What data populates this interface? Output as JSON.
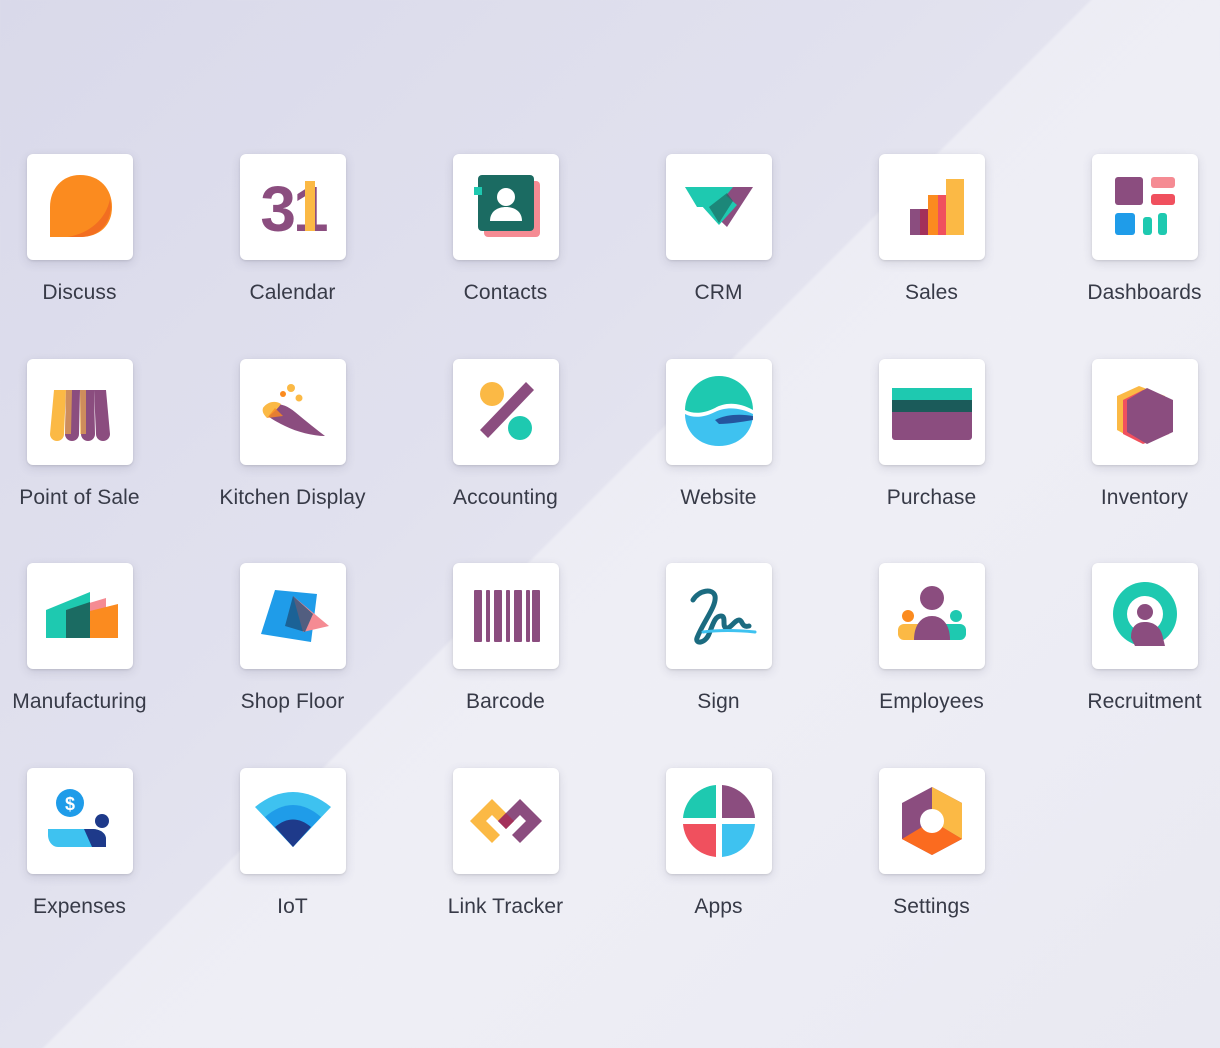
{
  "apps": [
    {
      "label": "Discuss",
      "icon": "discuss-icon"
    },
    {
      "label": "Calendar",
      "icon": "calendar-icon",
      "icon_text": "31"
    },
    {
      "label": "Contacts",
      "icon": "contacts-icon"
    },
    {
      "label": "CRM",
      "icon": "crm-icon"
    },
    {
      "label": "Sales",
      "icon": "sales-icon"
    },
    {
      "label": "Dashboards",
      "icon": "dashboards-icon"
    },
    {
      "label": "Point of Sale",
      "icon": "point-of-sale-icon"
    },
    {
      "label": "Kitchen Display",
      "icon": "kitchen-display-icon"
    },
    {
      "label": "Accounting",
      "icon": "accounting-icon"
    },
    {
      "label": "Website",
      "icon": "website-icon"
    },
    {
      "label": "Purchase",
      "icon": "purchase-icon"
    },
    {
      "label": "Inventory",
      "icon": "inventory-icon"
    },
    {
      "label": "Manufacturing",
      "icon": "manufacturing-icon"
    },
    {
      "label": "Shop Floor",
      "icon": "shop-floor-icon"
    },
    {
      "label": "Barcode",
      "icon": "barcode-icon"
    },
    {
      "label": "Sign",
      "icon": "sign-icon"
    },
    {
      "label": "Employees",
      "icon": "employees-icon"
    },
    {
      "label": "Recruitment",
      "icon": "recruitment-icon"
    },
    {
      "label": "Expenses",
      "icon": "expenses-icon",
      "icon_text": "$"
    },
    {
      "label": "IoT",
      "icon": "iot-icon"
    },
    {
      "label": "Link Tracker",
      "icon": "link-tracker-icon"
    },
    {
      "label": "Apps",
      "icon": "apps-icon"
    },
    {
      "label": "Settings",
      "icon": "settings-icon"
    }
  ],
  "colors": {
    "purple": "#8b4d7f",
    "orange": "#fb8b1f",
    "yellow": "#fbb945",
    "teal": "#1ec9b0",
    "dark_teal": "#1b6b62",
    "blue": "#1f9ce9",
    "light_blue": "#3ec2f0",
    "red": "#f0505e",
    "pink": "#f58b93",
    "label_text": "#373a47"
  }
}
